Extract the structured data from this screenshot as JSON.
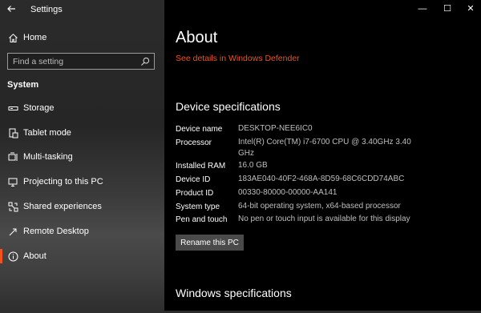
{
  "window": {
    "title": "Settings",
    "back_icon": "back-arrow-icon",
    "controls": {
      "minimize": "—",
      "maximize": "☐",
      "close": "✕"
    }
  },
  "sidebar": {
    "home_label": "Home",
    "search_placeholder": "Find a setting",
    "section_label": "System",
    "items": [
      {
        "label": "Storage",
        "icon": "storage-icon"
      },
      {
        "label": "Tablet mode",
        "icon": "tablet-icon"
      },
      {
        "label": "Multi-tasking",
        "icon": "multitasking-icon"
      },
      {
        "label": "Projecting to this PC",
        "icon": "projecting-icon"
      },
      {
        "label": "Shared experiences",
        "icon": "shared-experiences-icon"
      },
      {
        "label": "Remote Desktop",
        "icon": "remote-desktop-icon"
      },
      {
        "label": "About",
        "icon": "info-icon",
        "selected": true
      }
    ]
  },
  "main": {
    "title": "About",
    "defender_link": "See details in Windows Defender",
    "device_specs_heading": "Device specifications",
    "specs": [
      {
        "label": "Device name",
        "value": "DESKTOP-NEE6IC0"
      },
      {
        "label": "Processor",
        "value": "Intel(R) Core(TM) i7-6700 CPU @ 3.40GHz   3.40 GHz"
      },
      {
        "label": "Installed RAM",
        "value": "16.0 GB"
      },
      {
        "label": "Device ID",
        "value": "183AE040-40F2-468A-8D59-68C6CDD74ABC"
      },
      {
        "label": "Product ID",
        "value": "00330-80000-00000-AA141"
      },
      {
        "label": "System type",
        "value": "64-bit operating system, x64-based processor"
      },
      {
        "label": "Pen and touch",
        "value": "No pen or touch input is available for this display"
      }
    ],
    "rename_button": "Rename this PC",
    "windows_specs_heading": "Windows specifications"
  },
  "colors": {
    "accent": "#f4511e",
    "background": "#000000",
    "sidebar": "#2b2b2b"
  }
}
